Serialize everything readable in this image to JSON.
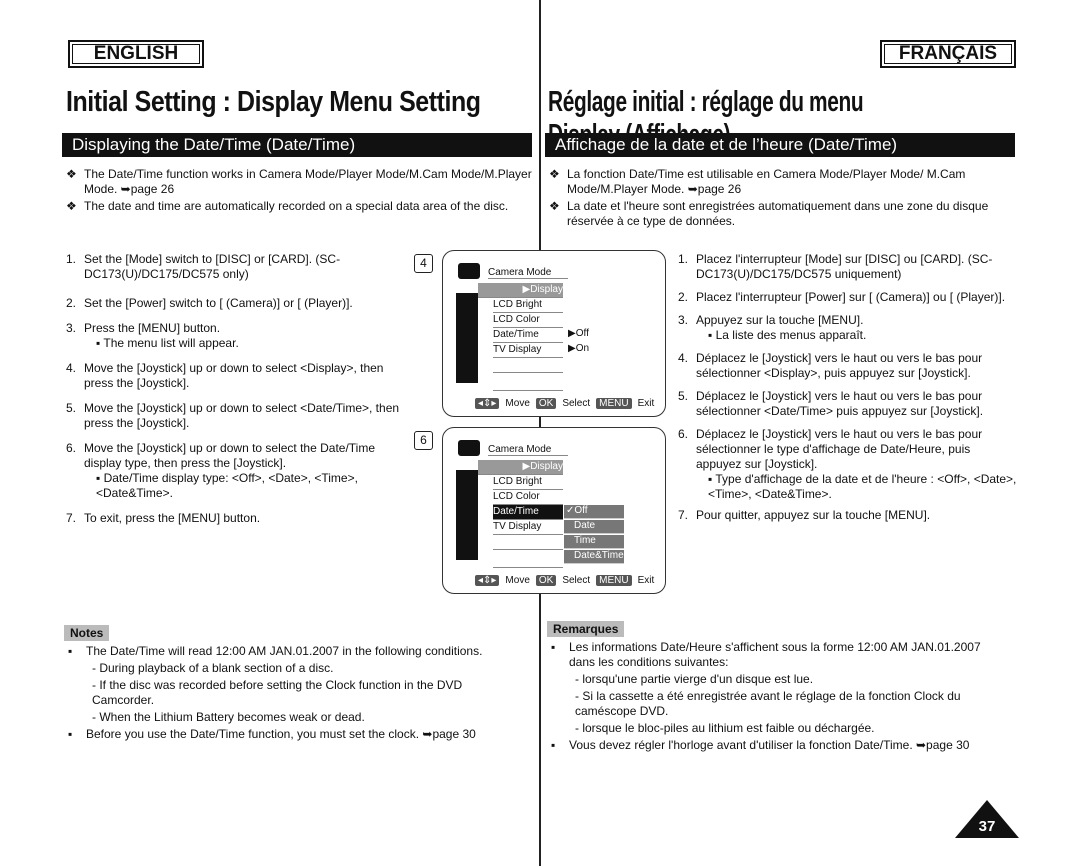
{
  "lang": {
    "en": "ENGLISH",
    "fr": "FRANÇAIS"
  },
  "titles": {
    "en": "Initial Setting : Display Menu Setting",
    "fr": "Réglage initial : réglage du menu Display (Affichage)"
  },
  "sections": {
    "en": "Displaying the Date/Time (Date/Time)",
    "fr": "Affichage de la date et de l’heure (Date/Time)"
  },
  "en": {
    "intro": [
      "The Date/Time function works in Camera Mode/Player Mode/M.Cam Mode/M.Player Mode. ➥page 26",
      "The date and time are automatically recorded on a special data area of the disc."
    ],
    "steps": [
      {
        "n": "1.",
        "t": "Set the [Mode] switch to [DISC] or [CARD]. (SC-DC173(U)/DC175/DC575 only)"
      },
      {
        "n": "2.",
        "t": "Set the [Power] switch to [ (Camera)] or [ (Player)]."
      },
      {
        "n": "3.",
        "t": "Press the [MENU] button.",
        "sub": "The menu list will appear."
      },
      {
        "n": "4.",
        "t": "Move the [Joystick] up or down to select <Display>, then press the [Joystick]."
      },
      {
        "n": "5.",
        "t": "Move the [Joystick] up or down to select <Date/Time>, then press the [Joystick]."
      },
      {
        "n": "6.",
        "t": "Move the [Joystick] up or down to select the Date/Time display type, then press the [Joystick].",
        "sub": "Date/Time display type: <Off>, <Date>, <Time>, <Date&Time>."
      },
      {
        "n": "7.",
        "t": "To exit, press the [MENU] button."
      }
    ],
    "notes_label": "Notes",
    "notes": [
      "The Date/Time will read 12:00 AM JAN.01.2007 in the following conditions.",
      "- During playback of a blank section of a disc.",
      "- If the disc was recorded before setting the Clock function in the DVD Camcorder.",
      "- When the Lithium Battery becomes weak or dead.",
      "Before you use the Date/Time function, you must set the clock. ➥page 30"
    ]
  },
  "fr": {
    "intro": [
      "La fonction Date/Time est utilisable en Camera Mode/Player Mode/ M.Cam Mode/M.Player Mode. ➥page 26",
      "La date et l'heure sont enregistrées automatiquement dans une zone du disque réservée à ce type de données."
    ],
    "steps": [
      {
        "n": "1.",
        "t": "Placez l'interrupteur [Mode] sur [DISC] ou [CARD]. (SC-DC173(U)/DC175/DC575 uniquement)"
      },
      {
        "n": "2.",
        "t": "Placez l'interrupteur [Power] sur [ (Camera)] ou [ (Player)]."
      },
      {
        "n": "3.",
        "t": "Appuyez sur la touche [MENU].",
        "sub": "La liste des menus apparaît."
      },
      {
        "n": "4.",
        "t": "Déplacez le [Joystick] vers le haut ou vers le bas pour sélectionner <Display>, puis appuyez sur [Joystick]."
      },
      {
        "n": "5.",
        "t": "Déplacez le [Joystick] vers le haut ou vers le bas pour sélectionner <Date/Time> puis appuyez sur [Joystick]."
      },
      {
        "n": "6.",
        "t": "Déplacez le [Joystick] vers le haut ou vers le bas pour sélectionner le type d'affichage de Date/Heure, puis appuyez sur [Joystick].",
        "sub": "Type d'affichage de la date et de l'heure : <Off>, <Date>, <Time>, <Date&Time>."
      },
      {
        "n": "7.",
        "t": "Pour quitter, appuyez sur la touche [MENU]."
      }
    ],
    "notes_label": "Remarques",
    "notes": [
      "Les informations Date/Heure s'affichent sous la forme 12:00 AM JAN.01.2007 dans les conditions suivantes:",
      "- lorsqu'une partie vierge d'un disque est lue.",
      "- Si la cassette a été enregistrée avant le réglage de la fonction Clock du caméscope DVD.",
      "- lorsque le bloc-piles au lithium est faible ou déchargée.",
      "Vous devez régler l'horloge avant d'utiliser la fonction Date/Time. ➥page 30"
    ]
  },
  "screens": [
    {
      "step": "4",
      "mode": "Camera Mode",
      "items": [
        "▶Display",
        "LCD Bright",
        "LCD Color",
        "Date/Time",
        "TV Display"
      ],
      "values": [
        "▶Off",
        "▶On"
      ],
      "footer": {
        "move": "Move",
        "ok": "OK",
        "select": "Select",
        "menu": "MENU",
        "exit": "Exit"
      }
    },
    {
      "step": "6",
      "mode": "Camera Mode",
      "items": [
        "▶Display",
        "LCD Bright",
        "LCD Color",
        "Date/Time",
        "TV Display"
      ],
      "options": [
        "✓Off",
        "Date",
        "Time",
        "Date&Time"
      ],
      "footer": {
        "move": "Move",
        "ok": "OK",
        "select": "Select",
        "menu": "MENU",
        "exit": "Exit"
      }
    }
  ],
  "page_number": "37"
}
